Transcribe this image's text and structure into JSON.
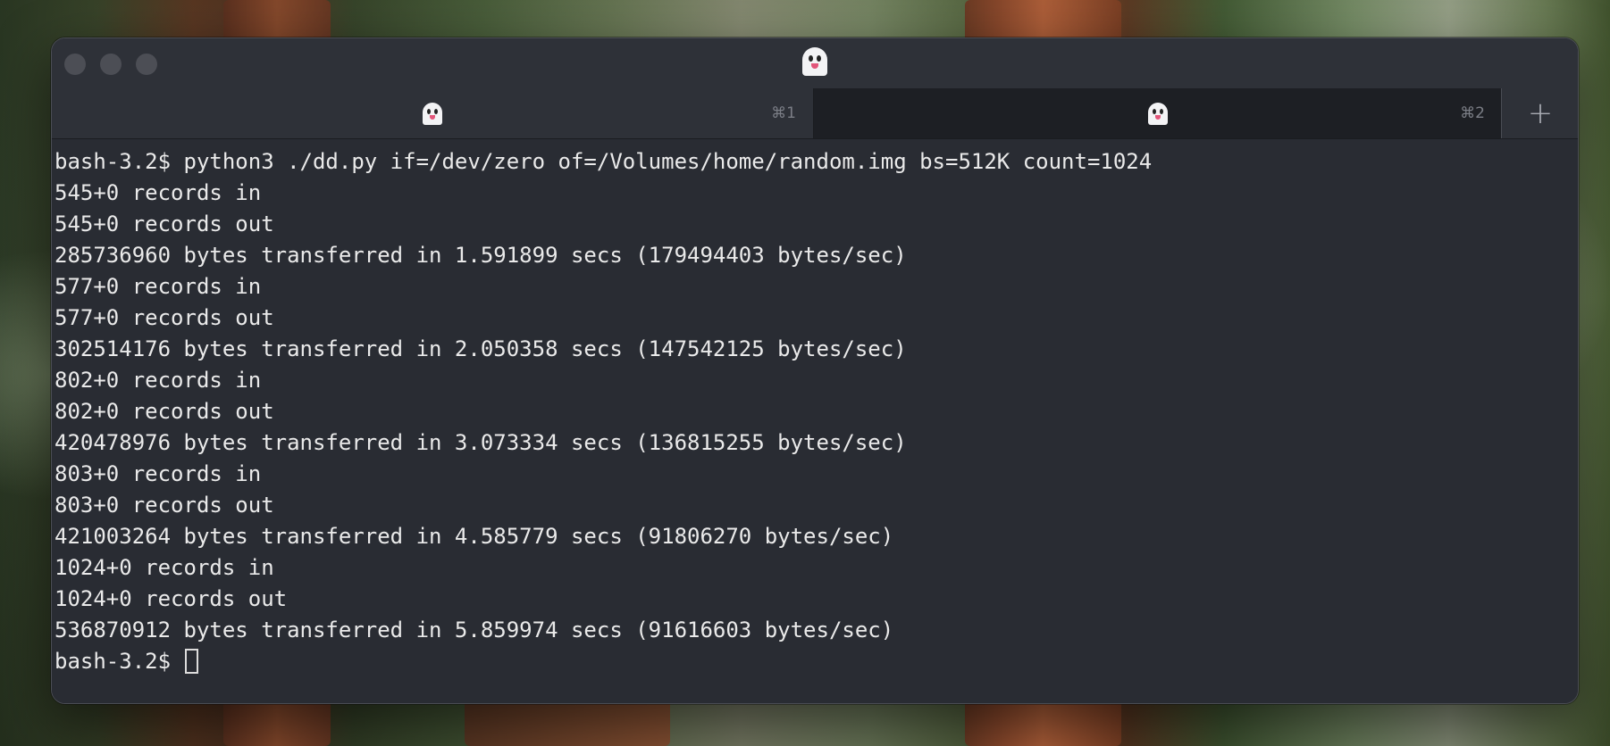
{
  "window": {
    "title_icon": "ghost-icon"
  },
  "tabs": [
    {
      "icon": "ghost-icon",
      "shortcut": "⌘1",
      "active": false
    },
    {
      "icon": "ghost-icon",
      "shortcut": "⌘2",
      "active": true
    }
  ],
  "new_tab_label": "+",
  "terminal": {
    "lines": [
      "bash-3.2$ python3 ./dd.py if=/dev/zero of=/Volumes/home/random.img bs=512K count=1024",
      "545+0 records in",
      "545+0 records out",
      "285736960 bytes transferred in 1.591899 secs (179494403 bytes/sec)",
      "577+0 records in",
      "577+0 records out",
      "302514176 bytes transferred in 2.050358 secs (147542125 bytes/sec)",
      "802+0 records in",
      "802+0 records out",
      "420478976 bytes transferred in 3.073334 secs (136815255 bytes/sec)",
      "803+0 records in",
      "803+0 records out",
      "421003264 bytes transferred in 4.585779 secs (91806270 bytes/sec)",
      "1024+0 records in",
      "1024+0 records out",
      "536870912 bytes transferred in 5.859974 secs (91616603 bytes/sec)"
    ],
    "prompt": "bash-3.2$ "
  },
  "colors": {
    "terminal_bg": "#292c33",
    "terminal_fg": "#eaeaea",
    "titlebar_bg": "#2e3138",
    "active_tab_bg": "#1d1f24"
  }
}
